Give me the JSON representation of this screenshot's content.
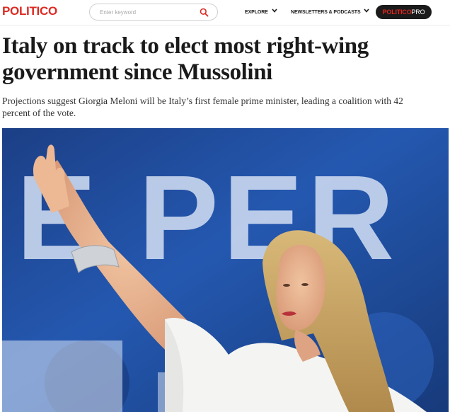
{
  "header": {
    "logo_text": "POLITICO",
    "search": {
      "placeholder": "Enter keyword",
      "value": "",
      "icon": "search-icon"
    },
    "nav": [
      {
        "label": "EXPLORE",
        "icon": "chevron-down-icon"
      },
      {
        "label": "NEWSLETTERS & PODCASTS",
        "icon": "chevron-down-icon"
      }
    ],
    "pro": {
      "main": "POLITICO",
      "suffix": "PRO"
    }
  },
  "article": {
    "headline": "Italy on track to elect most right-wing government since Mussolini",
    "dek": "Projections suggest Giorgia Meloni will be Italy’s first female prime minister, leading a coalition with 42 percent of the vote.",
    "image": {
      "backdrop_text": "E PER"
    }
  },
  "colors": {
    "brand_red": "#dc2a22",
    "pro_badge_bg": "#1b1b1b",
    "text_primary": "#1a1a1a",
    "hero_blue": "#1f4fa0"
  }
}
